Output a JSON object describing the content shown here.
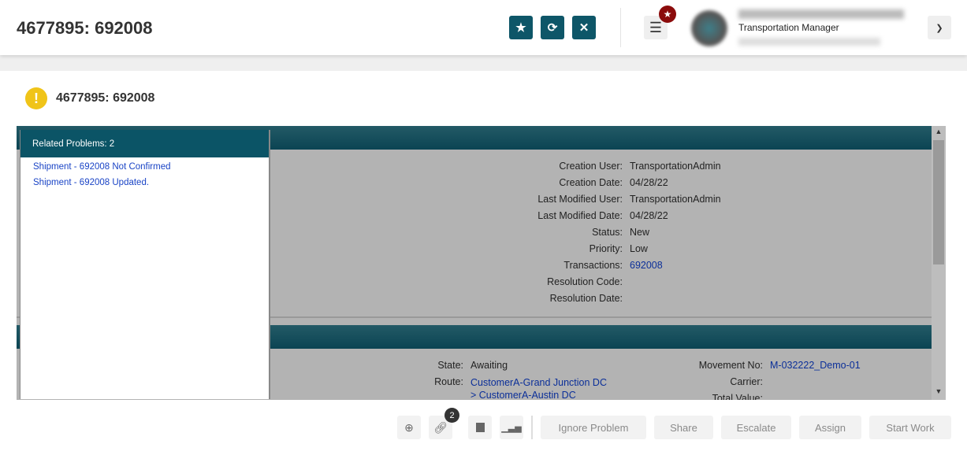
{
  "header": {
    "title": "4677895: 692008",
    "role": "Transportation Manager"
  },
  "card": {
    "title": "4677895: 692008"
  },
  "details": [
    {
      "label": "Creation User:",
      "value": "TransportationAdmin"
    },
    {
      "label": "Creation Date:",
      "value": "04/28/22"
    },
    {
      "label": "Last Modified User:",
      "value": "TransportationAdmin"
    },
    {
      "label": "Last Modified Date:",
      "value": "04/28/22"
    },
    {
      "label": "Status:",
      "value": "New"
    },
    {
      "label": "Priority:",
      "value": "Low"
    },
    {
      "label": "Transactions:",
      "value": "692008"
    },
    {
      "label": "Resolution Code:",
      "value": ""
    },
    {
      "label": "Resolution Date:",
      "value": ""
    }
  ],
  "shipment": {
    "state_label": "State:",
    "state": "Awaiting",
    "route_label": "Route:",
    "route1": "CustomerA-Grand Junction DC",
    "route2": "> CustomerA-Austin DC",
    "movement_label": "Movement No:",
    "movement": "M-032222_Demo-01",
    "carrier_label": "Carrier:",
    "total_label": "Total Value:"
  },
  "related": {
    "title": "Related Problems: 2",
    "items": [
      "Shipment - 692008 Not Confirmed",
      "Shipment - 692008 Updated."
    ]
  },
  "footer": {
    "link_count": "2",
    "buttons": [
      "Ignore Problem",
      "Share",
      "Escalate",
      "Assign",
      "Start Work"
    ]
  }
}
